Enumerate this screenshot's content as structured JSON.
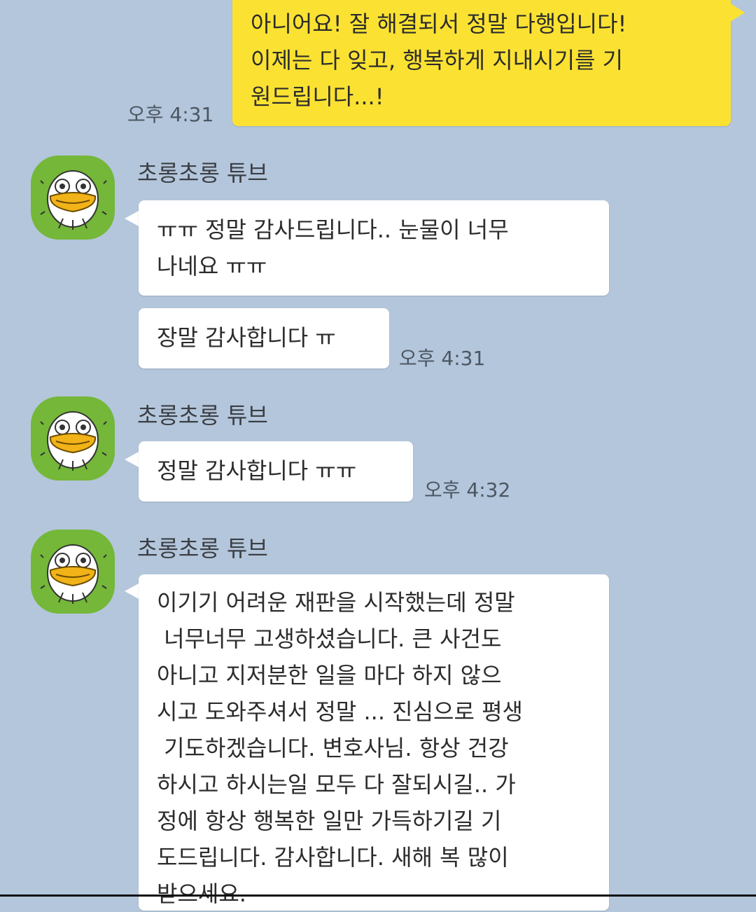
{
  "sender_name": "초롱초롱 튜브",
  "colors": {
    "background": "#b4c6db",
    "my_bubble": "#fbe232",
    "their_bubble": "#ffffff",
    "avatar_bg": "#74b739"
  },
  "avatar_icon": "duck-tube-emoticon-icon",
  "messages": [
    {
      "from": "me",
      "text": "아니어요! 잘 해결되서 정말 다행입니다!\n이제는 다 잊고, 행복하게 지내시기를 기\n원드립니다...!",
      "time": "오후 4:31"
    },
    {
      "from": "them",
      "bubbles": [
        "ㅠㅠ 정말 감사드립니다.. 눈물이 너무\n나네요 ㅠㅠ",
        "장말 감사합니다 ㅠ"
      ],
      "time": "오후 4:31"
    },
    {
      "from": "them",
      "bubbles": [
        "정말 감사합니다 ㅠㅠ"
      ],
      "time": "오후 4:32"
    },
    {
      "from": "them",
      "bubbles": [
        "이기기 어려운 재판을 시작했는데 정말\n 너무너무 고생하셨습니다. 큰 사건도\n아니고 지저분한 일을 마다 하지 않으\n시고 도와주셔서 정말 ... 진심으로 평생\n 기도하겠습니다. 변호사님. 항상 건강\n하시고 하시는일 모두 다 잘되시길.. 가\n정에 항상 행복한 일만 가득하기길 기\n도드립니다. 감사합니다. 새해 복 많이\n받으세요."
      ]
    }
  ]
}
